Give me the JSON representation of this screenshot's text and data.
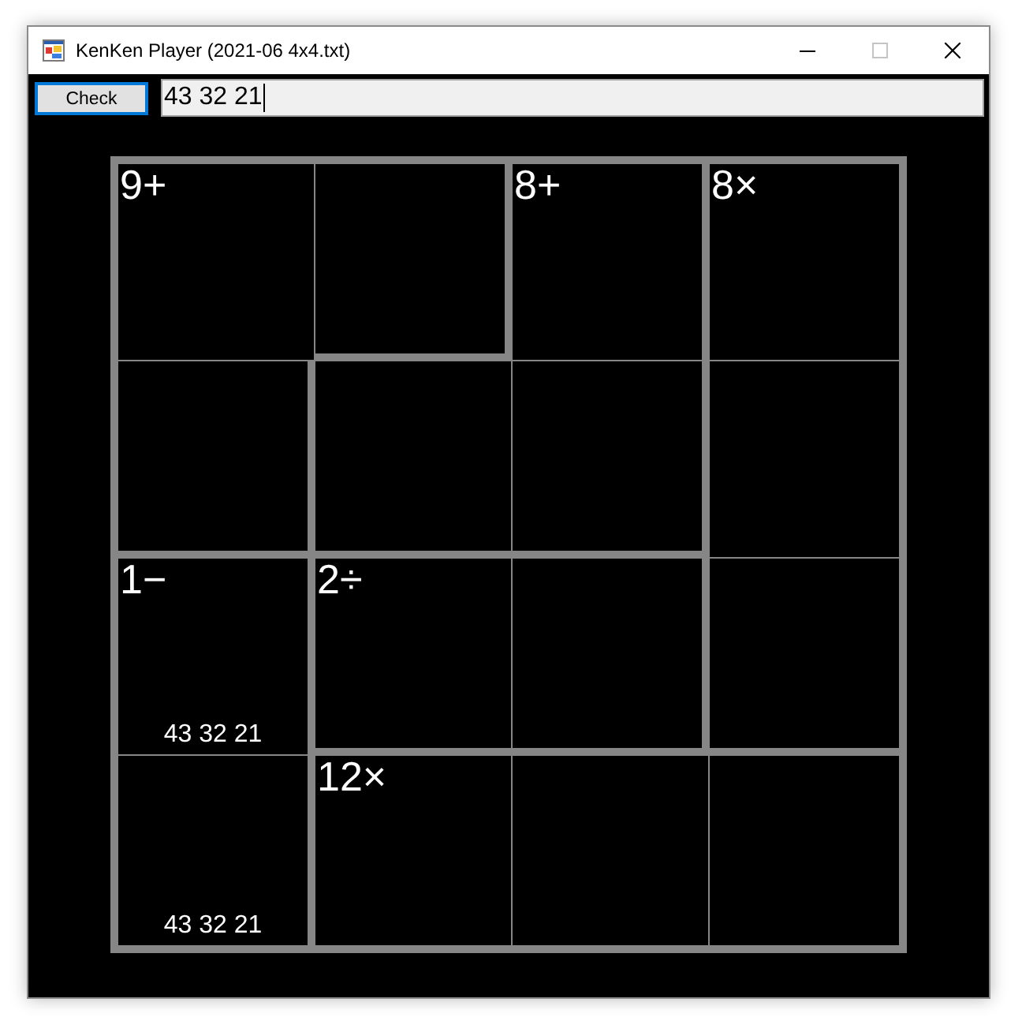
{
  "window": {
    "title": "KenKen Player (2021-06 4x4.txt)",
    "controls": [
      {
        "kind": "minimize",
        "disabled": false
      },
      {
        "kind": "maximize",
        "disabled": true
      },
      {
        "kind": "close",
        "disabled": false
      }
    ]
  },
  "toolbar": {
    "check_button": {
      "label": "Check",
      "is_default": true
    },
    "answer_field": {
      "value": "43 32 21",
      "focused": true
    }
  },
  "grid": {
    "rows": [
      {
        "cells": [
          {
            "clue": "9+",
            "wall_right": false,
            "wall_bottom": false
          },
          {
            "wall_right": true,
            "wall_bottom": true
          },
          {
            "clue": "8+",
            "wall_right": true,
            "wall_bottom": false
          },
          {
            "clue": "8×",
            "wall_right": true,
            "wall_bottom": false
          }
        ]
      },
      {
        "cells": [
          {
            "wall_right": true,
            "wall_bottom": true
          },
          {
            "wall_right": false,
            "wall_bottom": true
          },
          {
            "wall_right": true,
            "wall_bottom": true
          },
          {
            "wall_right": true,
            "wall_bottom": false
          }
        ]
      },
      {
        "cells": [
          {
            "clue": "1−",
            "wall_right": true,
            "wall_bottom": false,
            "candidates": "43 32 21"
          },
          {
            "clue": "2÷",
            "wall_right": false,
            "wall_bottom": true
          },
          {
            "wall_right": true,
            "wall_bottom": true
          },
          {
            "wall_right": true,
            "wall_bottom": true
          }
        ]
      },
      {
        "cells": [
          {
            "candidates": "43 32 21",
            "wall_right": true,
            "wall_bottom": true
          },
          {
            "clue": "12×",
            "wall_right": false,
            "wall_bottom": true
          },
          {
            "wall_right": false,
            "wall_bottom": true
          },
          {
            "wall_right": true,
            "wall_bottom": true
          }
        ]
      }
    ]
  }
}
